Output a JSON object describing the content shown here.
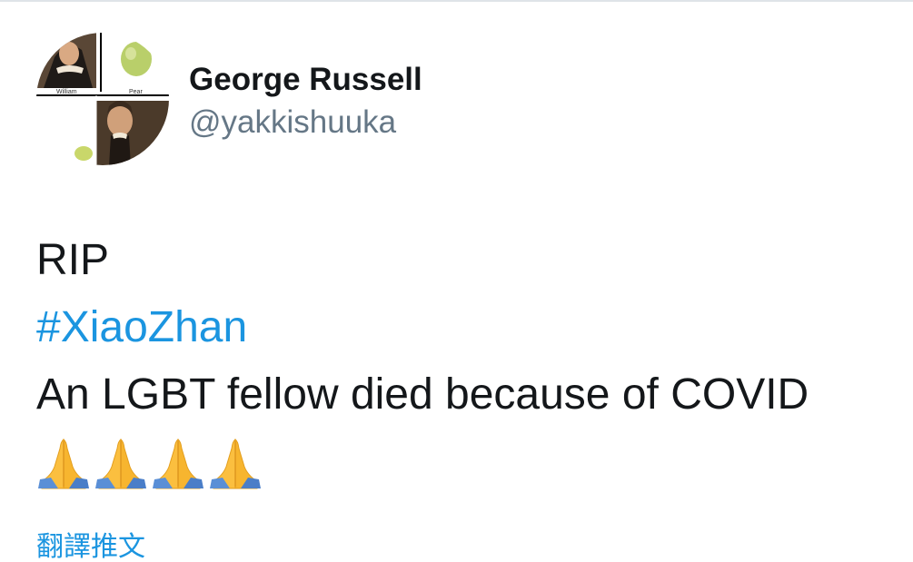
{
  "tweet": {
    "avatar": {
      "panel_labels": [
        "William",
        "Pear"
      ]
    },
    "author": {
      "display_name": "George Russell",
      "handle": "@yakkishuuka"
    },
    "body": {
      "line1": "RIP",
      "hashtag": "#XiaoZhan",
      "line3": "An LGBT fellow died because of COVID",
      "emoji": [
        "folded-hands-icon",
        "folded-hands-icon",
        "folded-hands-icon",
        "folded-hands-icon"
      ]
    },
    "translate_label": "翻譯推文"
  },
  "colors": {
    "text_primary": "#14171a",
    "text_secondary": "#657786",
    "link": "#1b95e0",
    "divider": "#dfe4e8"
  }
}
